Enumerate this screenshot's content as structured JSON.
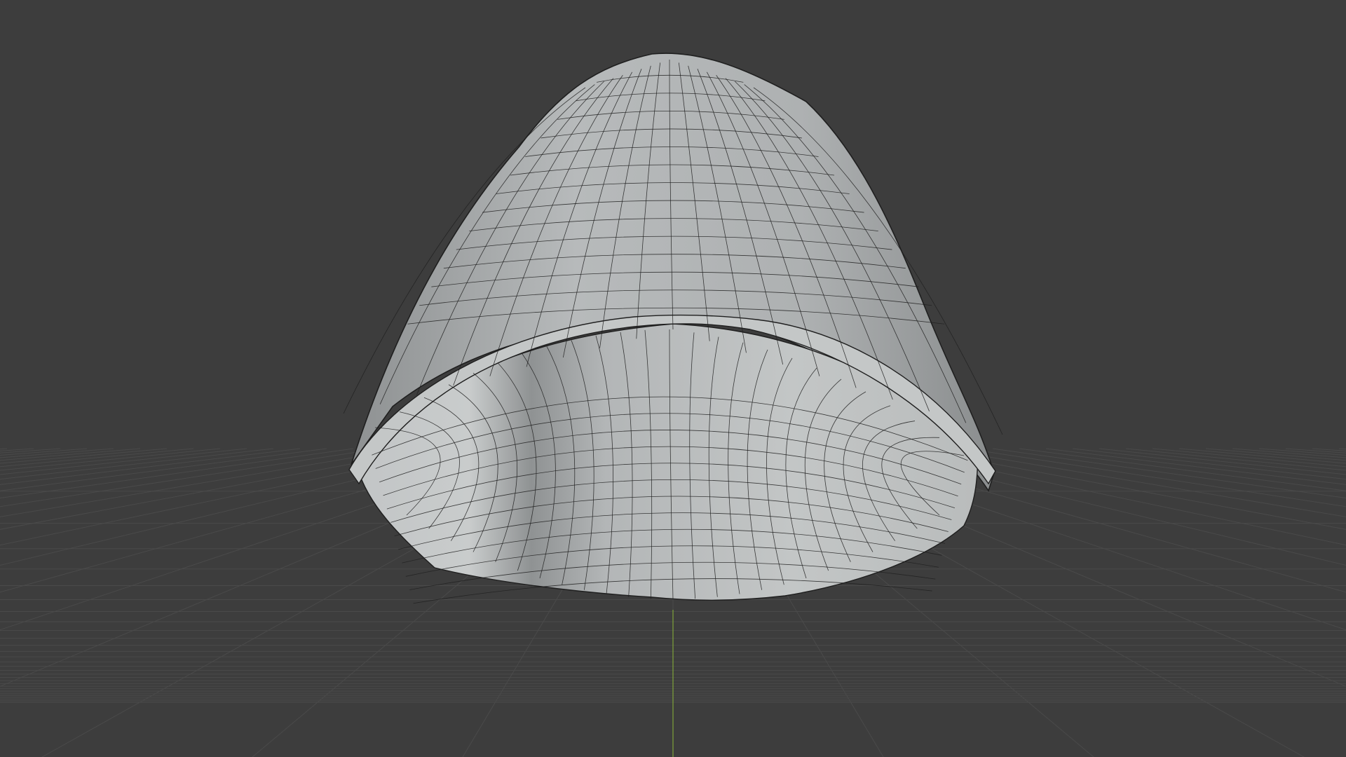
{
  "viewport": {
    "background_color": "#3d3d3d",
    "grid_color": "#4a4a4a",
    "y_axis_color": "#7fa33a",
    "view": "perspective"
  },
  "mesh": {
    "shape": "open hollow bell / dome shell",
    "material_color": "#b9bcbd",
    "wireframe_color": "#202020",
    "shading": "solid"
  }
}
